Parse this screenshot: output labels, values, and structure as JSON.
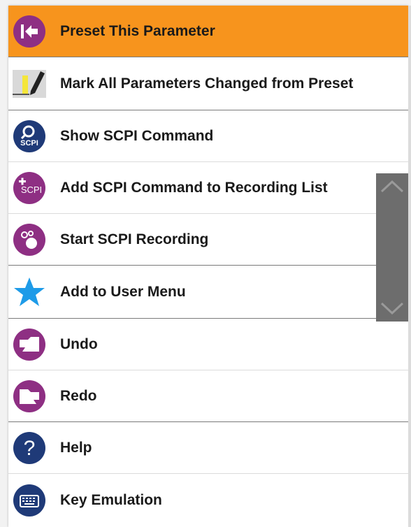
{
  "menu": {
    "items": [
      {
        "label": "Preset This Parameter",
        "icon": "preset-arrow-icon"
      },
      {
        "label": "Mark All Parameters Changed from Preset",
        "icon": "pencil-mark-icon"
      },
      {
        "label": "Show SCPI Command",
        "icon": "show-scpi-icon",
        "icon_text": "SCPI"
      },
      {
        "label": "Add SCPI Command to Recording List",
        "icon": "add-scpi-icon",
        "icon_text": "SCPI"
      },
      {
        "label": "Start SCPI Recording",
        "icon": "recording-icon"
      },
      {
        "label": "Add to User Menu",
        "icon": "star-icon"
      },
      {
        "label": "Undo",
        "icon": "undo-icon"
      },
      {
        "label": "Redo",
        "icon": "redo-icon"
      },
      {
        "label": "Help",
        "icon": "help-icon",
        "icon_text": "?"
      },
      {
        "label": "Key Emulation",
        "icon": "keyboard-icon"
      }
    ],
    "selected_index": 0
  },
  "colors": {
    "selected_bg": "#f7941d",
    "purple_icon": "#8e2f83",
    "navy_icon": "#1f3a78",
    "star": "#1e9be8",
    "scrollbar": "#6d6d6d"
  }
}
